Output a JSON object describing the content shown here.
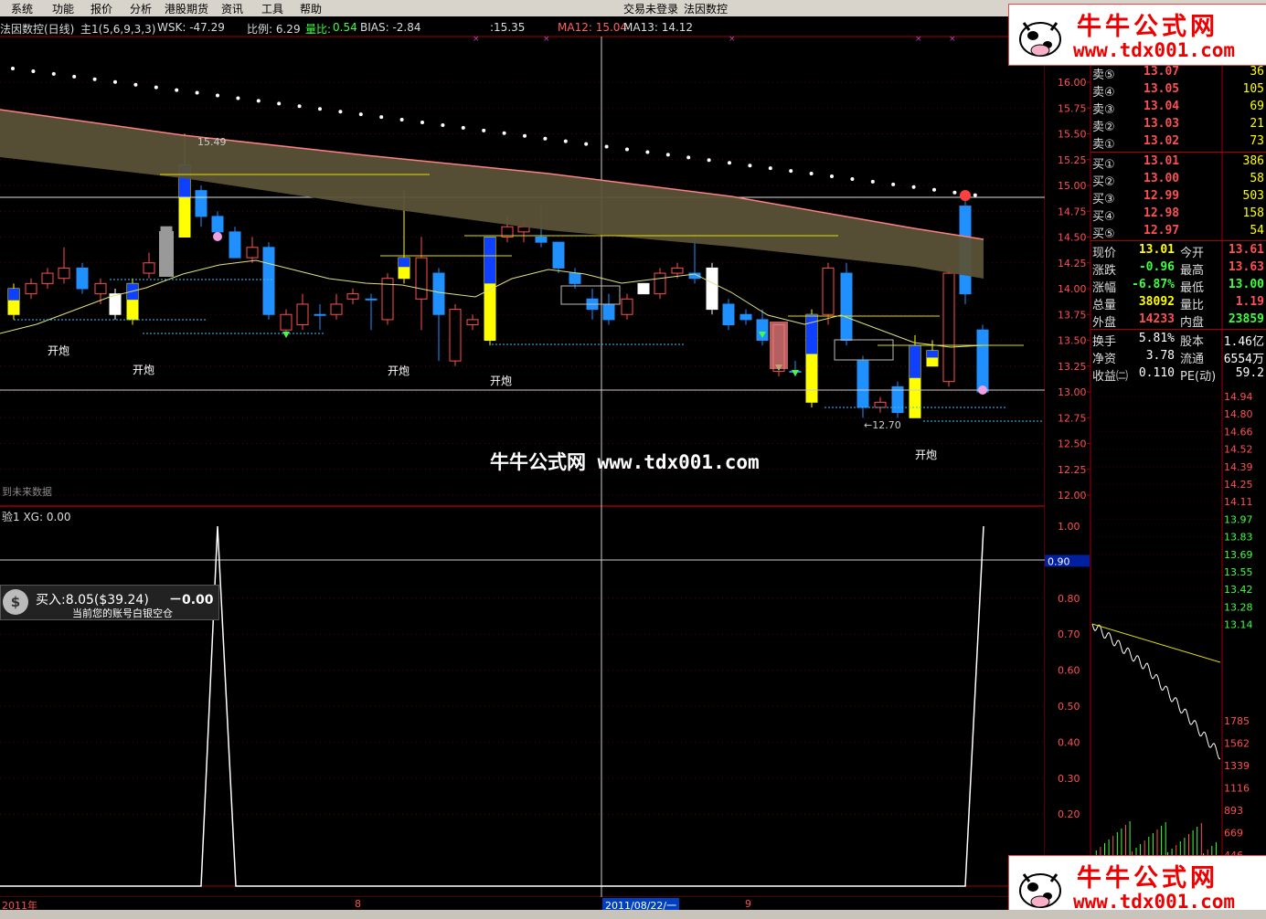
{
  "menu": [
    "系统",
    "功能",
    "报价",
    "分析",
    "港股期货",
    "资讯",
    "工具",
    "帮助"
  ],
  "title_status": "交易未登录",
  "title_stock": "法因数控",
  "header": {
    "name": "法因数控(日线)",
    "main": "主1(5,6,9,3,3)",
    "wsk": "WSK: -47.29",
    "ratio": "比例: 6.29",
    "volratio_label": "量比:",
    "volratio_value": "0.54",
    "bias": "BIAS: -2.84",
    "v1535": ":15.35",
    "ma12": "MA12: 15.04",
    "ma13": "MA13: 14.12"
  },
  "price_axis": [
    "16.00",
    "15.75",
    "15.50",
    "15.25",
    "15.00",
    "14.75",
    "14.50",
    "14.25",
    "14.00",
    "13.75",
    "13.50",
    "13.25",
    "13.00",
    "12.75",
    "12.50",
    "12.25",
    "12.00"
  ],
  "annotations": {
    "high": "15.49",
    "low": "←12.70",
    "kp": "开炮",
    "future": "到未来数据"
  },
  "watermark": "牛牛公式网 www.tdx001.com",
  "indicator": {
    "header": "验1 XG: 0.00",
    "axis": [
      "1.00",
      "0.90",
      "0.80",
      "0.70",
      "0.60",
      "0.50",
      "0.40",
      "0.30",
      "0.20"
    ],
    "current": "0.90"
  },
  "date_axis": {
    "year": "2011年",
    "m8": "8",
    "cursor": "2011/08/22/一",
    "m9": "9"
  },
  "trade": {
    "buy": "买入:8.05($39.24)",
    "change": "－0.00",
    "account": "当前您的账号白银空仓"
  },
  "orderbook": {
    "sell": [
      {
        "label": "卖⑤",
        "price": "13.07",
        "vol": "36"
      },
      {
        "label": "卖④",
        "price": "13.05",
        "vol": "105"
      },
      {
        "label": "卖③",
        "price": "13.04",
        "vol": "69"
      },
      {
        "label": "卖②",
        "price": "13.03",
        "vol": "21"
      },
      {
        "label": "卖①",
        "price": "13.02",
        "vol": "73"
      }
    ],
    "buy": [
      {
        "label": "买①",
        "price": "13.01",
        "vol": "386"
      },
      {
        "label": "买②",
        "price": "13.00",
        "vol": "58"
      },
      {
        "label": "买③",
        "price": "12.99",
        "vol": "503"
      },
      {
        "label": "买④",
        "price": "12.98",
        "vol": "158"
      },
      {
        "label": "买⑤",
        "price": "12.97",
        "vol": "54"
      }
    ]
  },
  "quote": [
    {
      "l1": "现价",
      "v1": "13.01",
      "c1": "#ffff00",
      "l2": "今开",
      "v2": "13.61",
      "c2": "#ff5050"
    },
    {
      "l1": "涨跌",
      "v1": "-0.96",
      "c1": "#40ff40",
      "l2": "最高",
      "v2": "13.63",
      "c2": "#ff5050"
    },
    {
      "l1": "涨幅",
      "v1": "-6.87%",
      "c1": "#40ff40",
      "l2": "最低",
      "v2": "13.00",
      "c2": "#40ff40"
    },
    {
      "l1": "总量",
      "v1": "38092",
      "c1": "#ffff00",
      "l2": "量比",
      "v2": "1.19",
      "c2": "#ff5050"
    },
    {
      "l1": "外盘",
      "v1": "14233",
      "c1": "#ff5050",
      "l2": "内盘",
      "v2": "23859",
      "c2": "#40ff40"
    }
  ],
  "fundamentals": [
    {
      "l1": "换手",
      "v1": "5.81%",
      "l2": "股本",
      "v2": "1.46亿"
    },
    {
      "l1": "净资",
      "v1": "3.78",
      "l2": "流通",
      "v2": "6554万"
    },
    {
      "l1": "收益㈡",
      "v1": "0.110",
      "l2": "PE(动)",
      "v2": "59.2"
    }
  ],
  "minute_axis": [
    "14.94",
    "14.80",
    "14.66",
    "14.52",
    "14.39",
    "14.25",
    "14.11",
    "13.97",
    "13.83",
    "13.69",
    "13.55",
    "13.42",
    "13.28",
    "13.14"
  ],
  "minute_vol_axis": [
    "1785",
    "1562",
    "1339",
    "1116",
    "893",
    "669",
    "446"
  ],
  "logo": {
    "t1": "牛牛公式网",
    "t2": "www.tdx001.com"
  },
  "colors": {
    "up": "#ff5050",
    "down": "#2090ff",
    "grid": "#a00000",
    "yellow": "#ffff00"
  }
}
